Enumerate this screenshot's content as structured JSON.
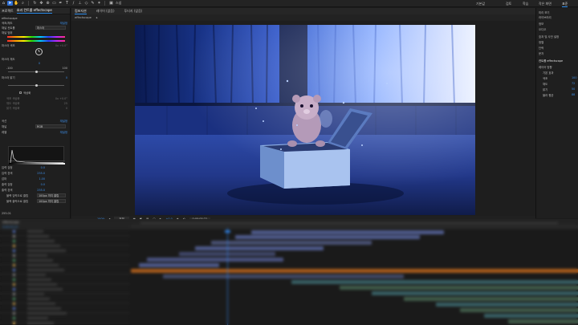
{
  "toolbar": {
    "tool_icons": [
      "selection-tool-icon",
      "hand-tool-icon",
      "zoom-tool-icon",
      "rotate-tool-icon",
      "camera-tool-icon",
      "pan-behind-icon",
      "shape-tool-icon",
      "pen-tool-icon",
      "type-tool-icon",
      "brush-tool-icon",
      "clone-stamp-icon",
      "eraser-tool-icon",
      "roto-brush-icon",
      "puppet-pin-icon"
    ],
    "snapping_label": "스냅",
    "workspaces": [
      "기본값",
      "검토",
      "학습",
      "작은 화면",
      "표준"
    ],
    "active_workspace": "표준"
  },
  "left_panel": {
    "tabs": [
      "프로젝트",
      "효과 컨트롤 effectscape"
    ],
    "active_tab": "효과 컨트롤 effectscape",
    "layer_title": "effectscape",
    "properties": [
      {
        "name": "색조/채도",
        "value": "재설정"
      },
      {
        "name": "채널 컨트롤",
        "value": "마스터"
      },
      {
        "name": "채널 범위",
        "value": ""
      },
      {
        "name": "마스터 색조",
        "value": "0x +0.0°"
      },
      {
        "name": "마스터 채도",
        "value": "0"
      },
      {
        "name": "마스터 밝기",
        "value": "0"
      },
      {
        "name": "색상화",
        "value": ""
      },
      {
        "name": "색조 색상화",
        "value": "0x +0.0°"
      },
      {
        "name": "채도 색상화",
        "value": "25"
      },
      {
        "name": "밝기 색상화",
        "value": "0"
      },
      {
        "name": "곡선",
        "value": "재설정"
      },
      {
        "name": "채널",
        "value": "RGB"
      },
      {
        "name": "레벨",
        "value": "재설정"
      },
      {
        "name": "입력 검정",
        "value": "0.0"
      },
      {
        "name": "입력 흰색",
        "value": "255.0"
      },
      {
        "name": "감마",
        "value": "1.00"
      },
      {
        "name": "출력 검정",
        "value": "0.0"
      },
      {
        "name": "출력 흰색",
        "value": "255.0"
      },
      {
        "name": "블랙 입력으로 클립",
        "value": "100px 까지 클립"
      },
      {
        "name": "블랙 출력으로 클립",
        "value": "100px 까지 클립"
      }
    ],
    "slider_min": "-100",
    "slider_max": "100",
    "channel_dropdown": "RGB",
    "footer": [
      "255.01"
    ]
  },
  "viewer": {
    "tabs": [
      "컴포지션",
      "레이어 (없음)",
      "푸티지 (없음)"
    ],
    "active_tab": "컴포지션",
    "comp_name": "effectscape",
    "footer": {
      "zoom": "100%",
      "resolution": "전체",
      "timecode": "0;00;05;22",
      "exposure": "+0.0"
    }
  },
  "right_panel": {
    "rows": [
      "미리 보기",
      "라이브러리",
      "정보",
      "오디오",
      "효과 및 사전 설정",
      "정렬",
      "단락",
      "문자",
      "컨트롤 effectscape",
      "레이어 방향",
      "기본 효과",
      "색조",
      "채도",
      "밝기",
      "블러 평균"
    ],
    "values": [
      "100",
      "72",
      "50",
      "88"
    ]
  },
  "timeline": {
    "comp_tab": "effectscape",
    "timecode": "0;00;05;22"
  },
  "colors": {
    "accent": "#2d8ceb",
    "bar_blue": "#5b6aa6",
    "bar_orange": "#c96a1c",
    "bar_green": "#4a6b55",
    "bar_teal": "#3e6f76"
  }
}
